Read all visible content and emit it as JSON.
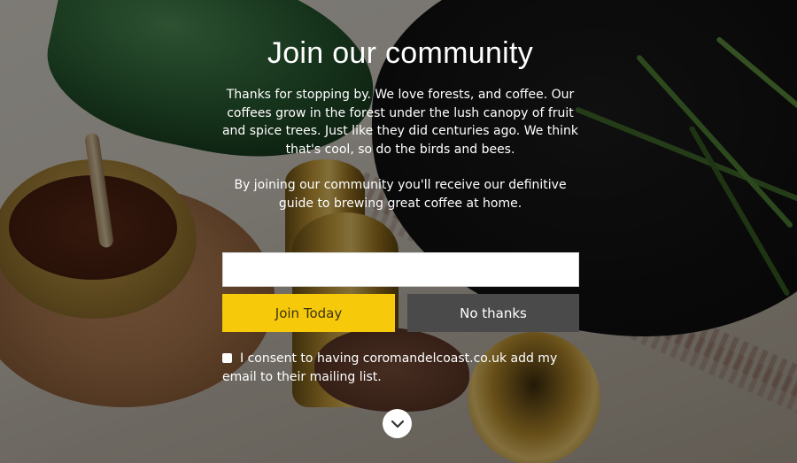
{
  "signup": {
    "title": "Join our community",
    "intro": "Thanks for stopping by. We love forests, and coffee. Our coffees grow in the forest under the lush canopy of fruit and spice trees. Just like they did centuries ago. We think that's cool, so do the birds and bees.",
    "offer": "By joining our community you'll receive our definitive guide to brewing great coffee at home.",
    "email_value": "",
    "email_placeholder": "",
    "join_label": "Join Today",
    "decline_label": "No thanks",
    "consent_text": "I consent to having coromandelcoast.co.uk add my email to their mailing list.",
    "consent_checked": false
  },
  "icons": {
    "scroll": "chevron-down-icon"
  },
  "colors": {
    "join_button": "#f6ca0b",
    "decline_button": "#4a4a4a",
    "text": "#ffffff"
  }
}
